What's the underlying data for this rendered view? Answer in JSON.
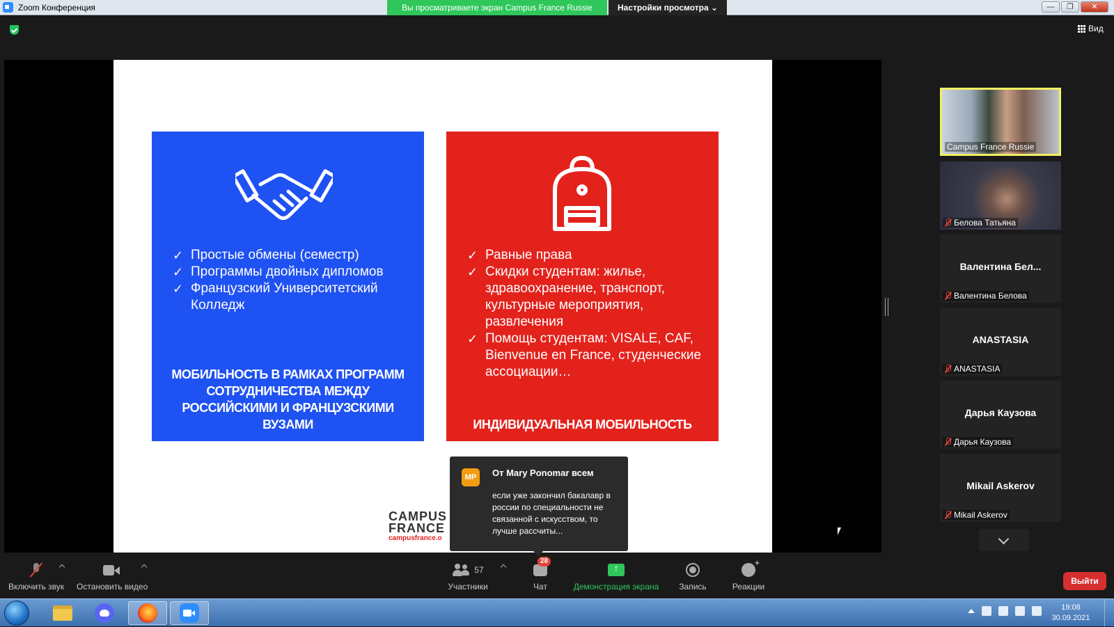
{
  "window": {
    "title": "Zoom Конференция",
    "share_banner": "Вы просматриваете экран Campus France Russie",
    "view_options": "Настройки просмотра ⌄",
    "minimize": "—",
    "restore": "❐",
    "close": "✕"
  },
  "top": {
    "view_label": "Вид"
  },
  "slide": {
    "left_card": {
      "items": [
        "Простые обмены (семестр)",
        "Программы двойных дипломов",
        "Французский Университетский Колледж"
      ],
      "footer": "МОБИЛЬНОСТЬ В РАМКАХ ПРОГРАММ СОТРУДНИЧЕСТВА МЕЖДУ РОССИЙСКИМИ И ФРАНЦУЗСКИМИ ВУЗАМИ"
    },
    "right_card": {
      "items": [
        "Равные права",
        "Скидки студентам: жилье, здравоохранение, транспорт, культурные мероприятия, развлечения",
        "Помощь студентам: VISALE, CAF, Bienvenue en France, студенческие ассоциации…"
      ],
      "footer": "ИНДИВИДУАЛЬНАЯ МОБИЛЬНОСТЬ"
    },
    "logo_line1": "CAMPUS",
    "logo_line2": "FRANCE",
    "logo_url": "campusfrance.o"
  },
  "chat_popup": {
    "initials": "MP",
    "sender": "От Mary Ponomar всем",
    "message": "если уже закончил бакалавр в россии по специальности не связанной с искусством, то лучше рассчиты..."
  },
  "participants": [
    {
      "name": "Campus France Russie",
      "big_name": "",
      "video": true,
      "active": true,
      "muted": false
    },
    {
      "name": "Белова Татьяна",
      "big_name": "",
      "video": true,
      "active": false,
      "muted": true
    },
    {
      "name": "Валентина Белова",
      "big_name": "Валентина Бел...",
      "video": false,
      "active": false,
      "muted": true
    },
    {
      "name": "ANASTASIA",
      "big_name": "ANASTASIA",
      "video": false,
      "active": false,
      "muted": true
    },
    {
      "name": "Дарья Каузова",
      "big_name": "Дарья Каузова",
      "video": false,
      "active": false,
      "muted": true
    },
    {
      "name": "Mikail Askerov",
      "big_name": "Mikail Askerov",
      "video": false,
      "active": false,
      "muted": true
    }
  ],
  "toolbar": {
    "unmute": "Включить звук",
    "stop_video": "Остановить видео",
    "participants_count": "57",
    "participants": "Участники",
    "chat_badge": "28",
    "chat": "Чат",
    "share_screen": "Демонстрация экрана",
    "record": "Запись",
    "reactions": "Реакции",
    "leave": "Выйти"
  },
  "taskbar": {
    "time": "19:08",
    "date": "30.09.2021"
  },
  "colors": {
    "blue_card": "#1f52f2",
    "red_card": "#e3221c",
    "zoom_green": "#2fc75b",
    "leave_red": "#d62f2f"
  }
}
